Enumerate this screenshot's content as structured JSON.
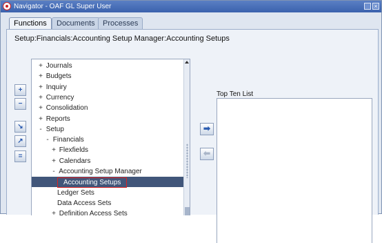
{
  "window": {
    "title": "Navigator - OAF GL Super User"
  },
  "tabs": [
    {
      "label": "Functions",
      "active": true
    },
    {
      "label": "Documents",
      "active": false
    },
    {
      "label": "Processes",
      "active": false
    }
  ],
  "breadcrumb": "Setup:Financials:Accounting Setup Manager:Accounting Setups",
  "tree": [
    {
      "toggle": "+",
      "label": "Journals",
      "level": 0
    },
    {
      "toggle": "+",
      "label": "Budgets",
      "level": 0
    },
    {
      "toggle": "+",
      "label": "Inquiry",
      "level": 0
    },
    {
      "toggle": "+",
      "label": "Currency",
      "level": 0
    },
    {
      "toggle": "+",
      "label": "Consolidation",
      "level": 0
    },
    {
      "toggle": "+",
      "label": "Reports",
      "level": 0
    },
    {
      "toggle": "-",
      "label": "Setup",
      "level": 0
    },
    {
      "toggle": "-",
      "label": "Financials",
      "level": 1
    },
    {
      "toggle": "+",
      "label": "Flexfields",
      "level": 2
    },
    {
      "toggle": "+",
      "label": "Calendars",
      "level": 2
    },
    {
      "toggle": "-",
      "label": "Accounting Setup Manager",
      "level": 2
    },
    {
      "toggle": "",
      "label": "Accounting Setups",
      "level": 3,
      "selected": true
    },
    {
      "toggle": "",
      "label": "Ledger Sets",
      "level": 3
    },
    {
      "toggle": "",
      "label": "Data Access Sets",
      "level": 3
    },
    {
      "toggle": "+",
      "label": "Definition Access Sets",
      "level": 2
    }
  ],
  "side_buttons": [
    {
      "name": "expand-button",
      "icon": "plus-icon",
      "glyph": "+"
    },
    {
      "name": "collapse-button",
      "icon": "minus-icon",
      "glyph": "−"
    },
    {
      "name": "expand-branch-button",
      "icon": "expand-branch-icon",
      "glyph": "↘"
    },
    {
      "name": "expand-all-button",
      "icon": "expand-all-icon",
      "glyph": "↗"
    },
    {
      "name": "collapse-all-button",
      "icon": "collapse-all-icon",
      "glyph": "="
    }
  ],
  "top_ten": {
    "label": "Top Ten List",
    "items": []
  },
  "colors": {
    "titlebar": "#3b62ad",
    "selection": "#41567a",
    "highlight_border": "#dd2222"
  }
}
